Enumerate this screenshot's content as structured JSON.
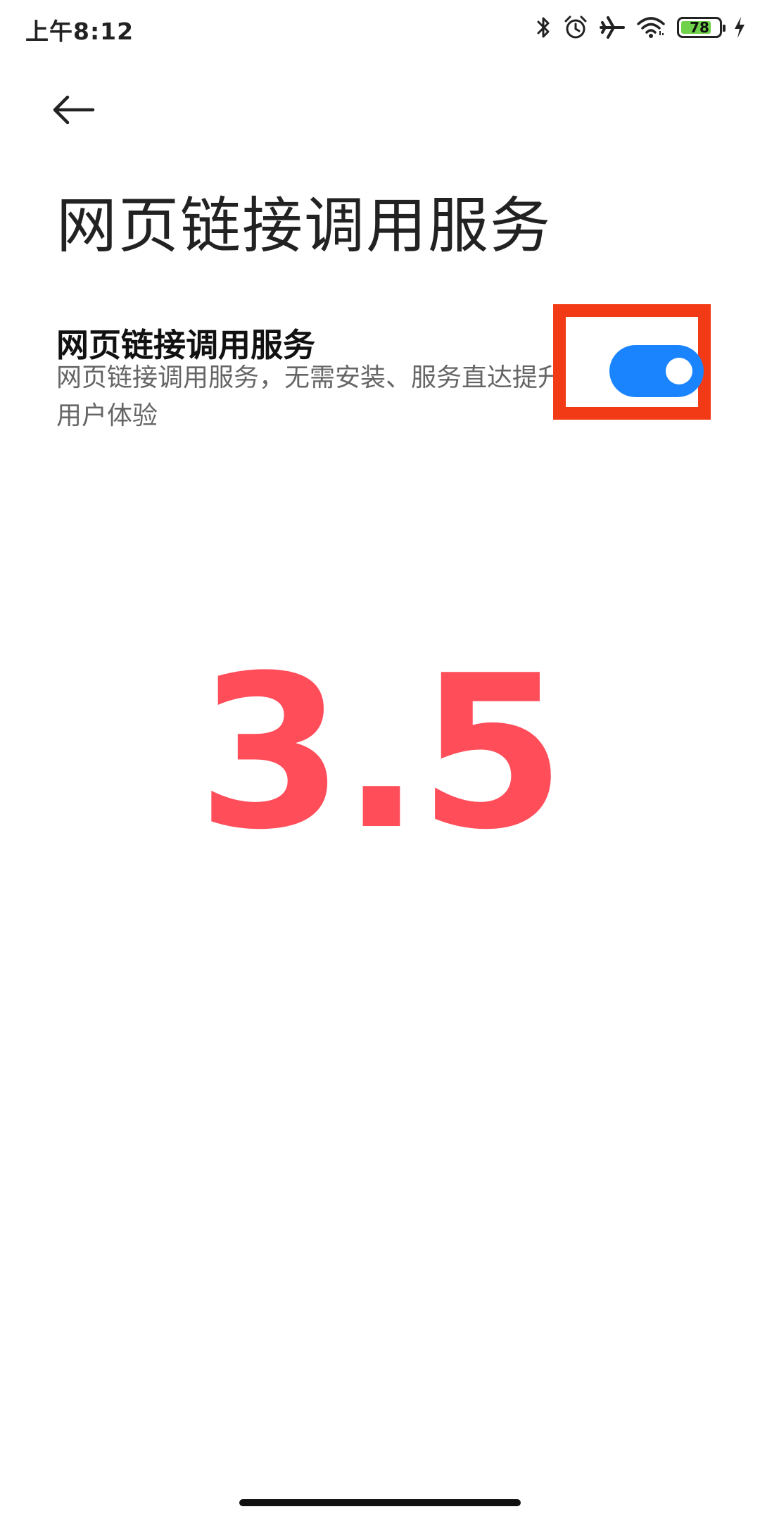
{
  "status_bar": {
    "time": "上午8:12",
    "battery_level": "78",
    "battery_fraction": 0.78,
    "icons": [
      "bluetooth-icon",
      "alarm-icon",
      "airplane-icon",
      "wifi-icon",
      "battery-icon",
      "charging-icon"
    ],
    "battery_fill_color": "#6fd24a"
  },
  "header": {
    "back_icon": "arrow-left-icon",
    "title": "网页链接调用服务"
  },
  "setting": {
    "title": "网页链接调用服务",
    "description": "网页链接调用服务，无需安装、服务直达提升用户体验",
    "toggle_on": true,
    "toggle_color": "#1a84ff",
    "highlight_color": "#f23a16"
  },
  "overlay": {
    "number": "3.5",
    "color": "#ff4d5a"
  }
}
